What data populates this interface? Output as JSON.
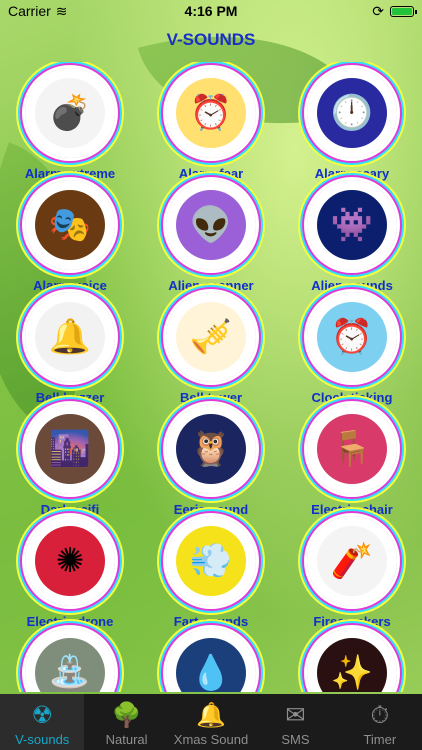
{
  "status": {
    "carrier": "Carrier",
    "time": "4:16 PM"
  },
  "header": {
    "title": "V-SOUNDS"
  },
  "sounds": [
    {
      "label": "Alarm extreme",
      "icon": "bomb-icon",
      "glyph": "💣",
      "bg": "#f4f4f4"
    },
    {
      "label": "Alarm fear",
      "icon": "alarm-clock-icon",
      "glyph": "⏰",
      "bg": "#ffe070"
    },
    {
      "label": "Alarm scary",
      "icon": "dark-clock-icon",
      "glyph": "🕛",
      "bg": "#2a2aa0"
    },
    {
      "label": "Alarm voice",
      "icon": "golden-face-icon",
      "glyph": "🎭",
      "bg": "#6a3b12"
    },
    {
      "label": "Alien scanner",
      "icon": "alien-icon",
      "glyph": "👽",
      "bg": "#9b5fd8"
    },
    {
      "label": "Alien sounds",
      "icon": "alien-head-icon",
      "glyph": "👾",
      "bg": "#0b1f6e"
    },
    {
      "label": "Bell buzzer",
      "icon": "bells-icon",
      "glyph": "🔔",
      "bg": "#f2f2f2"
    },
    {
      "label": "Bell tower",
      "icon": "kirby-icon",
      "glyph": "🎺",
      "bg": "#fff4d8"
    },
    {
      "label": "Clock ticking",
      "icon": "clock-icon",
      "glyph": "⏰",
      "bg": "#7ed0f0"
    },
    {
      "label": "Dark scifi",
      "icon": "city-icon",
      "glyph": "🌆",
      "bg": "#6b4a3a"
    },
    {
      "label": "Eerie sound",
      "icon": "owl-eyes-icon",
      "glyph": "🦉",
      "bg": "#1b2560"
    },
    {
      "label": "Electric chair",
      "icon": "chair-icon",
      "glyph": "🪑",
      "bg": "#d83a6a"
    },
    {
      "label": "Electric drone",
      "icon": "kaleidoscope-icon",
      "glyph": "✺",
      "bg": "#d8203a"
    },
    {
      "label": "Fart sounds",
      "icon": "fart-sign-icon",
      "glyph": "💨",
      "bg": "#f6e21a"
    },
    {
      "label": "Firecrackers",
      "icon": "firecracker-icon",
      "glyph": "🧨",
      "bg": "#f4f4f4"
    },
    {
      "label": "",
      "icon": "fountain-icon",
      "glyph": "⛲",
      "bg": "#7f8e7a"
    },
    {
      "label": "",
      "icon": "water-fan-icon",
      "glyph": "💧",
      "bg": "#1a3f7a"
    },
    {
      "label": "",
      "icon": "starburst-icon",
      "glyph": "✨",
      "bg": "#2a1010"
    }
  ],
  "tabs": [
    {
      "label": "V-sounds",
      "icon": "radiation-icon",
      "glyph": "☢",
      "active": true
    },
    {
      "label": "Natural",
      "icon": "tree-icon",
      "glyph": "🌳",
      "active": false
    },
    {
      "label": "Xmas Sound",
      "icon": "bell-icon",
      "glyph": "🔔",
      "active": false
    },
    {
      "label": "SMS",
      "icon": "envelope-icon",
      "glyph": "✉",
      "active": false
    },
    {
      "label": "Timer",
      "icon": "timer-icon",
      "glyph": "⏱",
      "active": false
    }
  ]
}
